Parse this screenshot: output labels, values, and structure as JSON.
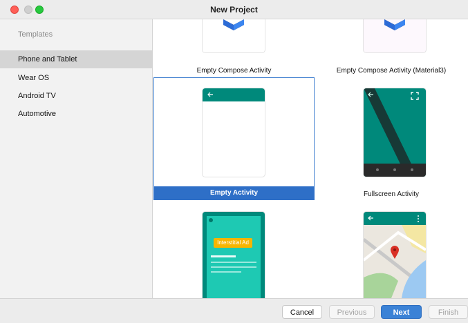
{
  "window": {
    "title": "New Project"
  },
  "sidebar": {
    "header": "Templates",
    "items": [
      {
        "label": "Phone and Tablet",
        "selected": true
      },
      {
        "label": "Wear OS",
        "selected": false
      },
      {
        "label": "Android TV",
        "selected": false
      },
      {
        "label": "Automotive",
        "selected": false
      }
    ]
  },
  "templates": [
    {
      "label": "Empty Compose Activity",
      "selected": false
    },
    {
      "label": "Empty Compose Activity (Material3)",
      "selected": false
    },
    {
      "label": "Empty Activity",
      "selected": true
    },
    {
      "label": "Fullscreen Activity",
      "selected": false
    },
    {
      "label": "",
      "ad_text": "Interstitial Ad",
      "selected": false
    },
    {
      "label": "",
      "selected": false
    }
  ],
  "footer": {
    "cancel": "Cancel",
    "previous": "Previous",
    "next": "Next",
    "finish": "Finish"
  },
  "colors": {
    "teal": "#00897b",
    "teal_light": "#1ec9b3",
    "accent_blue": "#2e6fc7",
    "ad_yellow": "#f7b500"
  }
}
